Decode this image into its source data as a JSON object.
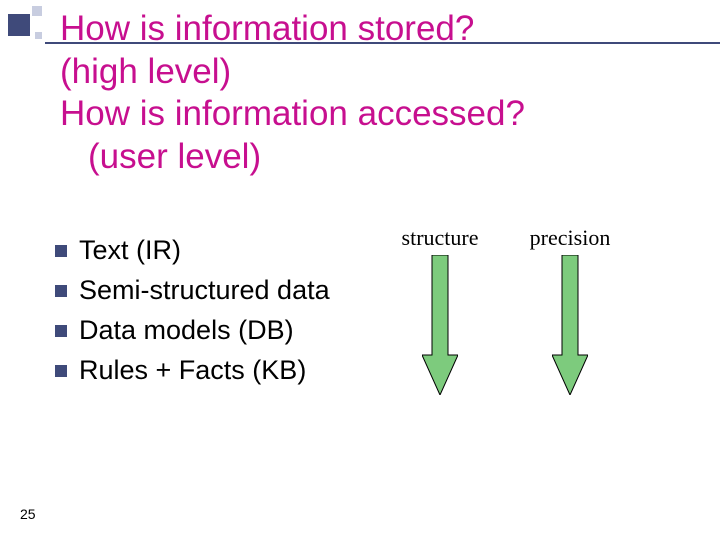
{
  "title": {
    "line1": "How is information stored?",
    "line2": "(high level)",
    "line3": "How is information accessed?",
    "line4": "(user level)"
  },
  "bullets": [
    "Text  (IR)",
    "Semi-structured data",
    "Data models (DB)",
    "Rules + Facts (KB)"
  ],
  "arrows": {
    "left_label": "structure",
    "right_label": "precision"
  },
  "colors": {
    "arrow_fill": "#7dcb7d",
    "arrow_stroke": "#000000"
  },
  "page_number": "25"
}
